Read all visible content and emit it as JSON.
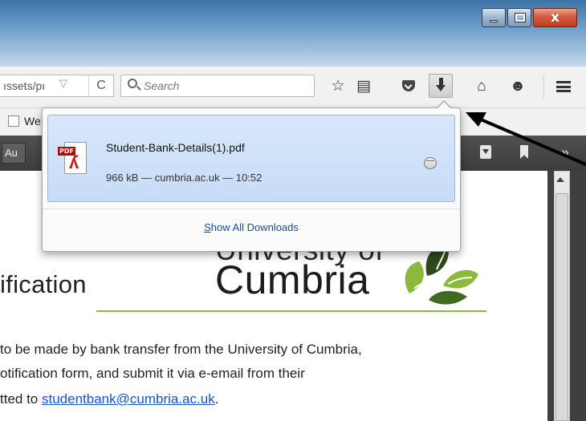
{
  "window": {
    "minimize_label": "–",
    "maximize_label": "",
    "close_label": "x"
  },
  "navbar": {
    "url_text": "ıssets/pı",
    "url_dropdown": "▽",
    "reload_glyph": "C",
    "search_placeholder": "Search",
    "icons": [
      "star-icon",
      "reading-list-icon",
      "pocket-icon",
      "download-icon",
      "home-icon",
      "smiley-icon",
      "menu-icon"
    ]
  },
  "bookmarks": {
    "first_label": "We"
  },
  "pdf_toolbar": {
    "zoom_text": "Au",
    "more_glyph": "»"
  },
  "downloads": {
    "item": {
      "file_name": "Student-Bank-Details(1).pdf",
      "status": "966 kB — cumbria.ac.uk — 10:52"
    },
    "show_all_prefix": "S",
    "show_all_rest": "how All Downloads"
  },
  "document": {
    "heading": "ification",
    "logo_line1": "University of",
    "logo_line2": "Cumbria",
    "body_line1": "to be made by bank transfer from the University of Cumbria,",
    "body_line2": "otification form, and submit it via e-email from their",
    "body_line3_prefix": "tted to ",
    "body_link": "studentbank@cumbria.ac.uk",
    "body_line3_suffix": "."
  },
  "colors": {
    "titlebar": "#5e93c2",
    "download_item_bg": "#c7dcf6",
    "link": "#1155cc",
    "logo_green": "#8bb93b",
    "pdf_toolbar": "#3c3c3c"
  }
}
